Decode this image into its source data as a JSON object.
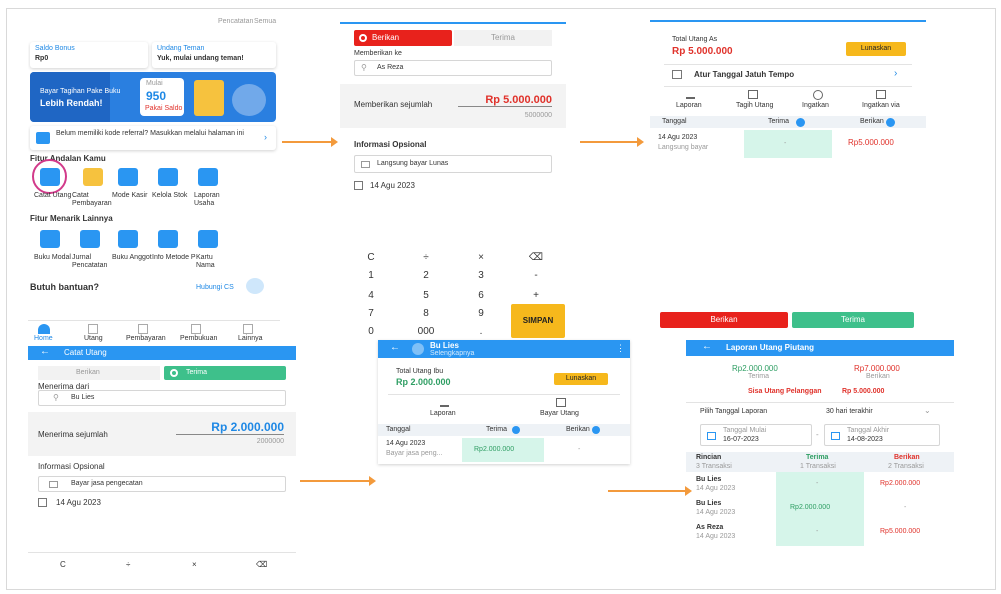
{
  "p1": {
    "top_links": [
      "Pencatatan",
      "Semua"
    ],
    "promo_card_left": {
      "title": "Saldo Bonus",
      "sub": "Rp0"
    },
    "promo_card_right": {
      "title": "Undang Teman",
      "sub": "Yuk, mulai undang teman!"
    },
    "banner": {
      "line1": "Bayar Tagihan Pake Buku",
      "line2": "Lebih Rendah!",
      "badge_top": "Mulai",
      "badge_num": "950",
      "badge_sub": "Pakai Saldo"
    },
    "notice": "Belum memiliki kode referral? Masukkan melalui halaman ini",
    "section1_title": "Fitur Andalan Kamu",
    "features1": [
      "Catat Utang",
      "Catat Pembayaran",
      "Mode Kasir",
      "Kelola Stok",
      "Laporan Usaha"
    ],
    "section2_title": "Fitur Menarik Lainnya",
    "features2": [
      "Buku Modal",
      "Jurnal Pencatatan",
      "Buku Anggota",
      "Info Metode Pembayaran",
      "Kartu Nama"
    ],
    "help_title": "Butuh bantuan?",
    "help_cs": "Hubungi CS",
    "nav": [
      "Home",
      "Utang",
      "Pembayaran",
      "Pembukuan",
      "Lainnya"
    ]
  },
  "p2": {
    "tab_left": "Berikan",
    "tab_right": "Terima",
    "customer_label": "Memberikan ke",
    "customer": "As Reza",
    "amount_label": "Memberikan sejumlah",
    "amount": "Rp 5.000.000",
    "amount_raw": "5000000",
    "optional_title": "Informasi Opsional",
    "note": "Langsung bayar Lunas",
    "date": "14 Agu 2023"
  },
  "keypad": {
    "rows": [
      [
        "C",
        "÷",
        "×",
        "⌫"
      ],
      [
        "1",
        "2",
        "3",
        "-"
      ],
      [
        "4",
        "5",
        "6",
        "+"
      ],
      [
        "7",
        "8",
        "9",
        ""
      ],
      [
        "0",
        "000",
        ".",
        ""
      ]
    ],
    "save": "SIMPAN"
  },
  "p3": {
    "total_label": "Total Utang As",
    "total": "Rp 5.000.000",
    "pay_button": "Lunaskan",
    "due_label": "Atur Tanggal Jatuh Tempo",
    "actions": [
      "Laporan",
      "Tagih Utang",
      "Ingatkan",
      "Ingatkan via"
    ],
    "cols": [
      "Tanggal",
      "Terima",
      "Berikan"
    ],
    "row_date": "14 Agu 2023",
    "row_note": "Langsung bayar",
    "row_dash": "-",
    "row_amount": "Rp5.000.000"
  },
  "p4": {
    "header": "Catat Utang",
    "tab_left": "Berikan",
    "tab_right": "Terima",
    "from_label": "Menerima dari",
    "customer": "Bu Lies",
    "amount_label": "Menerima sejumlah",
    "amount": "Rp 2.000.000",
    "amount_raw": "2000000",
    "optional_title": "Informasi Opsional",
    "note": "Bayar jasa pengecatan",
    "date": "14 Agu 2023",
    "keys": [
      "C",
      "÷",
      "×",
      "⌫"
    ]
  },
  "p5": {
    "header": "Bu Lies",
    "header_sub": "Selengkapnya",
    "total_label": "Total Utang Ibu",
    "total": "Rp 2.000.000",
    "pay_button": "Lunaskan",
    "actions": [
      "Laporan",
      "Bayar Utang"
    ],
    "cols": [
      "Tanggal",
      "Terima",
      "Berikan"
    ],
    "row_date": "14 Agu 2023",
    "row_note": "Bayar jasa peng...",
    "row_amount": "Rp2.000.000",
    "row_dash": "-"
  },
  "p6": {
    "btn_left": "Berikan",
    "btn_right": "Terima",
    "header": "Laporan Utang Piutang",
    "sum_left": "Rp2.000.000",
    "sum_left_label": "Terima",
    "sum_right": "Rp7.000.000",
    "sum_right_label": "Berikan",
    "balance_label": "Sisa Utang Pelanggan",
    "balance": "Rp 5.000.000",
    "period_label": "Pilih Tanggal Laporan",
    "period_value": "30 hari terakhir",
    "start_label": "Tanggal Mulai",
    "start": "16-07-2023",
    "end_label": "Tanggal Akhir",
    "end": "14-08-2023",
    "cols": [
      {
        "t": "Rincian",
        "s": "3 Transaksi"
      },
      {
        "t": "Terima",
        "s": "1 Transaksi"
      },
      {
        "t": "Berikan",
        "s": "2 Transaksi"
      }
    ],
    "rows": [
      {
        "name": "Bu Lies",
        "date": "14 Agu 2023",
        "terima": "-",
        "berikan": "Rp2.000.000"
      },
      {
        "name": "Bu Lies",
        "date": "14 Agu 2023",
        "terima": "Rp2.000.000",
        "berikan": "-"
      },
      {
        "name": "As Reza",
        "date": "14 Agu 2023",
        "terima": "-",
        "berikan": "Rp5.000.000"
      }
    ]
  },
  "colors": {
    "accent_blue": "#2a96f2",
    "red": "#e8221c",
    "green": "#3ec08b",
    "yellow": "#f6b81c",
    "arrow": "#f39a3c"
  }
}
